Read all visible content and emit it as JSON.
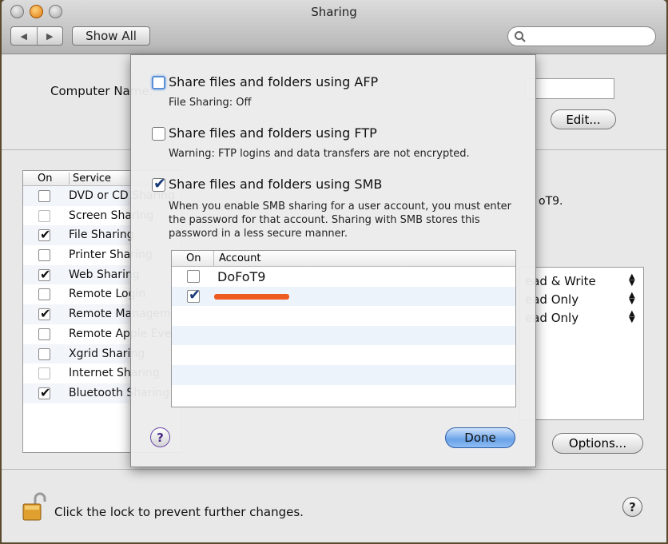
{
  "window": {
    "title": "Sharing"
  },
  "toolbar": {
    "back": "◀",
    "forward": "▶",
    "show_all": "Show All",
    "search_placeholder": ""
  },
  "main": {
    "computer_name_label": "Computer Name:",
    "edit_button": "Edit...",
    "services_header": {
      "on": "On",
      "service": "Service"
    },
    "services": [
      {
        "label": "DVD or CD Sharing",
        "checked": false
      },
      {
        "label": "Screen Sharing",
        "checked": false
      },
      {
        "label": "File Sharing",
        "checked": true
      },
      {
        "label": "Printer Sharing",
        "checked": false
      },
      {
        "label": "Web Sharing",
        "checked": true
      },
      {
        "label": "Remote Login",
        "checked": false
      },
      {
        "label": "Remote Management",
        "checked": true
      },
      {
        "label": "Remote Apple Events",
        "checked": false
      },
      {
        "label": "Xgrid Sharing",
        "checked": false
      },
      {
        "label": "Internet Sharing",
        "checked": false
      },
      {
        "label": "Bluetooth Sharing",
        "checked": true
      }
    ],
    "side_text": "oT9.",
    "permissions": [
      "ead & Write",
      "ead Only",
      "ead Only"
    ],
    "options_button": "Options...",
    "lock_text": "Click the lock to prevent further changes.",
    "help": "?"
  },
  "sheet": {
    "afp": {
      "label": "Share files and folders using AFP",
      "desc": "File Sharing: Off",
      "checked": false
    },
    "ftp": {
      "label": "Share files and folders using FTP",
      "desc": "Warning: FTP logins and data transfers are not encrypted.",
      "checked": false
    },
    "smb": {
      "label": "Share files and folders using SMB",
      "desc": "When you enable SMB sharing for a user account, you must enter the password for that account. Sharing with SMB stores this password in a less secure manner.",
      "checked": true
    },
    "accounts_header": {
      "on": "On",
      "account": "Account"
    },
    "accounts": [
      {
        "name": "DoFoT9",
        "checked": false
      },
      {
        "name": "",
        "checked": true,
        "redacted": true
      }
    ],
    "help": "?",
    "done_button": "Done"
  },
  "colors": {
    "accent": "#6aa3e8",
    "redaction": "#ee5a20"
  }
}
